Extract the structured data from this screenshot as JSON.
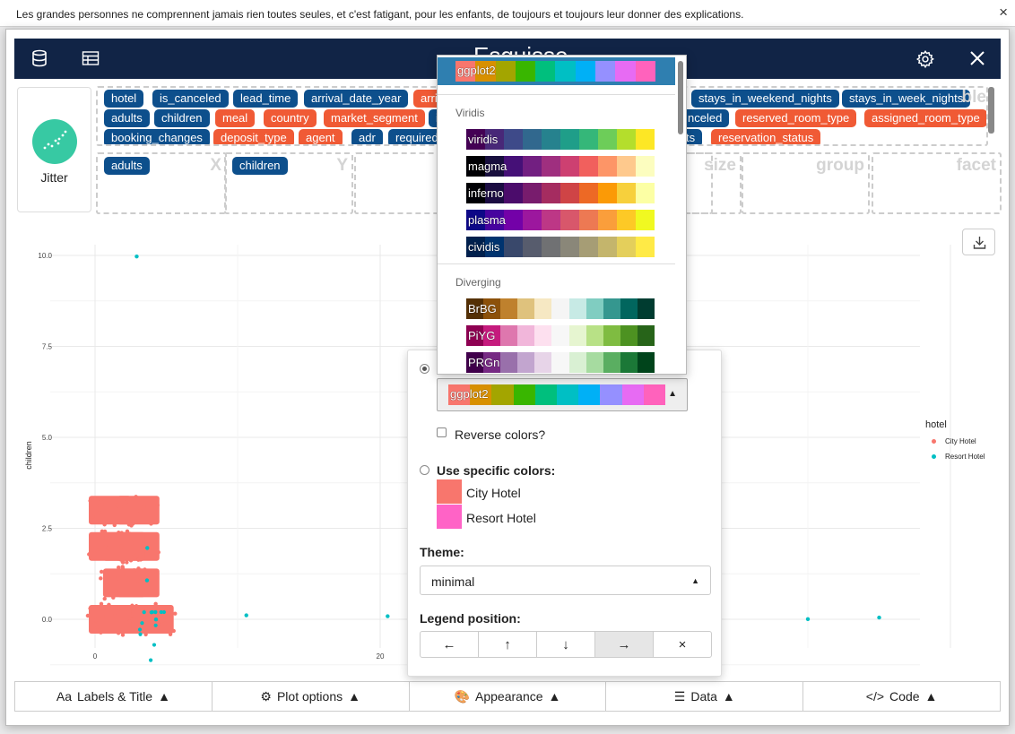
{
  "banner": {
    "text": "Les grandes personnes ne comprennent jamais rien toutes seules, et c'est fatigant, pour les enfants, de toujours et toujours leur donner des explications.",
    "close": "×"
  },
  "header": {
    "title": "Esquisse",
    "icons": [
      "database-icon",
      "table-icon",
      "settings-icon",
      "close-icon"
    ]
  },
  "geom": {
    "label": "Jitter"
  },
  "variables": [
    {
      "name": "hotel",
      "type": "cat"
    },
    {
      "name": "is_canceled",
      "type": "cat"
    },
    {
      "name": "lead_time",
      "type": "cat"
    },
    {
      "name": "arrival_date_year",
      "type": "cat"
    },
    {
      "name": "arriva",
      "type": "num"
    },
    {
      "name": "stays_in_weekend_nights",
      "type": "cat"
    },
    {
      "name": "stays_in_week_nights",
      "type": "cat"
    },
    {
      "name": "adults",
      "type": "cat"
    },
    {
      "name": "children",
      "type": "cat"
    },
    {
      "name": "meal",
      "type": "num"
    },
    {
      "name": "country",
      "type": "num"
    },
    {
      "name": "market_segment",
      "type": "num"
    },
    {
      "name": "i",
      "type": "cat"
    },
    {
      "name": "nceled",
      "type": "cat"
    },
    {
      "name": "reserved_room_type",
      "type": "num"
    },
    {
      "name": "assigned_room_type",
      "type": "num"
    },
    {
      "name": "booking_changes",
      "type": "cat"
    },
    {
      "name": "deposit_type",
      "type": "num"
    },
    {
      "name": "agent",
      "type": "num"
    },
    {
      "name": "adr",
      "type": "cat"
    },
    {
      "name": "required",
      "type": "cat"
    },
    {
      "name": "ts",
      "type": "cat"
    },
    {
      "name": "reservation_status",
      "type": "num"
    }
  ],
  "dropzones": [
    {
      "label": "X",
      "value": "adults"
    },
    {
      "label": "Y",
      "value": "children"
    },
    {
      "label": "",
      "value": ""
    },
    {
      "label": "size",
      "value": ""
    },
    {
      "label": "group",
      "value": ""
    },
    {
      "label": "facet",
      "value": ""
    }
  ],
  "varbox_hint": "ble",
  "chart_data": {
    "type": "scatter",
    "subtype": "jitter",
    "xlabel": "",
    "ylabel": "children",
    "x_ticks": [
      "0",
      "20"
    ],
    "y_ticks": [
      "0.0",
      "2.5",
      "5.0",
      "7.5",
      "10.0"
    ],
    "ylim": [
      -0.3,
      10.4
    ],
    "grid": true,
    "legend": {
      "title": "hotel",
      "position": "right",
      "items": [
        {
          "name": "City Hotel",
          "color": "#F8766D"
        },
        {
          "name": "Resort Hotel",
          "color": "#00BFC4"
        }
      ]
    },
    "series": [
      {
        "name": "City Hotel",
        "color": "#F8766D",
        "clusters": [
          {
            "x": 1,
            "y": 0
          },
          {
            "x": 2,
            "y": 0
          },
          {
            "x": 3,
            "y": 0
          },
          {
            "x": 1,
            "y": 1
          },
          {
            "x": 2,
            "y": 1
          },
          {
            "x": 2,
            "y": 2
          },
          {
            "x": 1,
            "y": 2
          },
          {
            "x": 0,
            "y": 0
          },
          {
            "x": 0,
            "y": 2
          },
          {
            "x": 0,
            "y": 3
          },
          {
            "x": 2,
            "y": 3
          }
        ]
      },
      {
        "name": "Resort Hotel",
        "color": "#00BFC4",
        "points": [
          {
            "x": 2,
            "y": 10
          },
          {
            "x": 10,
            "y": 0
          },
          {
            "x": 20,
            "y": 0
          },
          {
            "x": 50,
            "y": 0
          },
          {
            "x": 55,
            "y": 0
          },
          {
            "x": 4,
            "y": 0
          },
          {
            "x": 3,
            "y": 1
          },
          {
            "x": 3,
            "y": 2
          }
        ]
      }
    ]
  },
  "download_icon": "download-icon",
  "panel": {
    "selected_palette": "ggplot2",
    "reverse_label": "Reverse colors?",
    "specific_label": "Use specific colors:",
    "specific": [
      {
        "name": "City Hotel",
        "color": "#F8766D"
      },
      {
        "name": "Resort Hotel",
        "color": "#FF63C6"
      }
    ],
    "theme_label": "Theme:",
    "theme_value": "minimal",
    "legend_label": "Legend position:",
    "legend_buttons": [
      "←",
      "↑",
      "↓",
      "→",
      "×"
    ],
    "legend_selected": 3
  },
  "palette_dropdown": {
    "selected": {
      "name": "ggplot2",
      "colors": [
        "#F8766D",
        "#D89000",
        "#A3A500",
        "#39B600",
        "#00BF7D",
        "#00BFC4",
        "#00B0F6",
        "#9590FF",
        "#E76BF3",
        "#FF62BC"
      ]
    },
    "sections": [
      {
        "title": "Viridis",
        "palettes": [
          {
            "name": "viridis",
            "colors": [
              "#440154",
              "#482878",
              "#3E4A89",
              "#31688E",
              "#26828E",
              "#1F9E89",
              "#35B779",
              "#6DCD59",
              "#B4DE2C",
              "#FDE725"
            ]
          },
          {
            "name": "magma",
            "colors": [
              "#000004",
              "#180F3E",
              "#451077",
              "#721F81",
              "#9F2F7F",
              "#CD4071",
              "#F1605D",
              "#FD9567",
              "#FEC98D",
              "#FCFDBF"
            ]
          },
          {
            "name": "inferno",
            "colors": [
              "#000004",
              "#1B0C42",
              "#4B0C6B",
              "#781C6D",
              "#A52C60",
              "#CF4446",
              "#ED6925",
              "#FB9A06",
              "#F7D03C",
              "#FCFFA4"
            ]
          },
          {
            "name": "plasma",
            "colors": [
              "#0D0887",
              "#47039F",
              "#7301A8",
              "#9C179E",
              "#BD3786",
              "#D8576B",
              "#ED7953",
              "#FA9E3B",
              "#FDC926",
              "#F0F921"
            ]
          },
          {
            "name": "cividis",
            "colors": [
              "#00204D",
              "#00336F",
              "#39486B",
              "#575C6D",
              "#707173",
              "#8A8779",
              "#A69D75",
              "#C4B56C",
              "#E4CF5B",
              "#FFEA46"
            ]
          }
        ]
      },
      {
        "title": "Diverging",
        "palettes": [
          {
            "name": "BrBG",
            "colors": [
              "#543005",
              "#8C510A",
              "#BF812D",
              "#DFC27D",
              "#F6E8C3",
              "#F5F5F5",
              "#C7EAE5",
              "#80CDC1",
              "#35978F",
              "#01665E",
              "#003C30"
            ]
          },
          {
            "name": "PiYG",
            "colors": [
              "#8E0152",
              "#C51B7D",
              "#DE77AE",
              "#F1B6DA",
              "#FDE0EF",
              "#F7F7F7",
              "#E6F5D0",
              "#B8E186",
              "#7FBC41",
              "#4D9221",
              "#276419"
            ]
          },
          {
            "name": "PRGn",
            "colors": [
              "#40004B",
              "#762A83",
              "#9970AB",
              "#C2A5CF",
              "#E7D4E8",
              "#F7F7F7",
              "#D9F0D3",
              "#A6DBA0",
              "#5AAE61",
              "#1B7837",
              "#00441B"
            ]
          }
        ]
      }
    ]
  },
  "footer": [
    {
      "label": "Labels & Title",
      "icon": "text-format-icon"
    },
    {
      "label": "Plot options",
      "icon": "gear-icon"
    },
    {
      "label": "Appearance",
      "icon": "palette-icon"
    },
    {
      "label": "Data",
      "icon": "sliders-icon"
    },
    {
      "label": "Code",
      "icon": "code-icon"
    }
  ]
}
